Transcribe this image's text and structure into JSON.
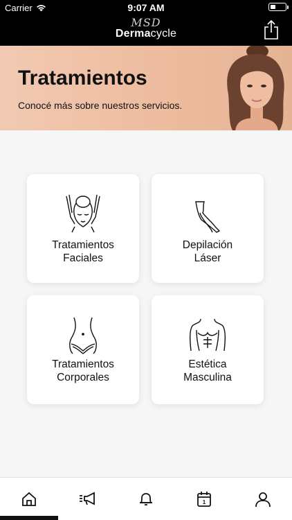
{
  "status_bar": {
    "carrier": "Carrier",
    "time": "9:07 AM"
  },
  "header": {
    "logo_monogram": "MSD",
    "logo_brand_bold": "Derma",
    "logo_brand_light": "cycle",
    "share_icon": "share-icon"
  },
  "hero": {
    "title": "Tratamientos",
    "subtitle": "Conocé más sobre nuestros servicios."
  },
  "cards": [
    {
      "line1": "Tratamientos",
      "line2": "Faciales",
      "icon": "facial-treatment-icon"
    },
    {
      "line1": "Depilación",
      "line2": "Láser",
      "icon": "legs-icon"
    },
    {
      "line1": "Tratamientos",
      "line2": "Corporales",
      "icon": "waist-icon"
    },
    {
      "line1": "Estética",
      "line2": "Masculina",
      "icon": "male-torso-icon"
    }
  ],
  "tabs": [
    {
      "icon": "home-icon",
      "selected": true
    },
    {
      "icon": "megaphone-icon",
      "selected": false
    },
    {
      "icon": "bell-icon",
      "selected": false
    },
    {
      "icon": "calendar-icon",
      "selected": false
    },
    {
      "icon": "user-icon",
      "selected": false
    }
  ],
  "calendar_icon_day": "1",
  "colors": {
    "header_bg": "#000000",
    "hero_bg": "#eebc9f",
    "card_bg": "#ffffff",
    "page_bg": "#f6f6f6"
  }
}
